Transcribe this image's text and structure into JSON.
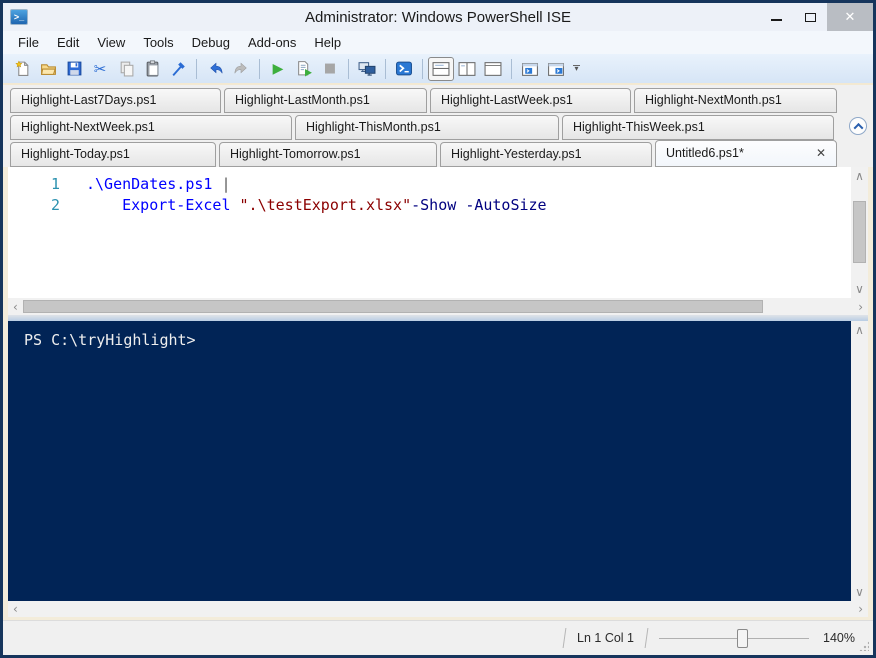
{
  "window": {
    "title": "Administrator: Windows PowerShell ISE",
    "minimize_glyph": "–",
    "close_glyph": "✕"
  },
  "menu": {
    "items": [
      "File",
      "Edit",
      "View",
      "Tools",
      "Debug",
      "Add-ons",
      "Help"
    ]
  },
  "toolbar": {
    "buttons": [
      "new-script",
      "open-script",
      "save-script",
      "cut",
      "copy",
      "paste",
      "clear-console-pane",
      "undo",
      "redo",
      "run-script",
      "run-selection",
      "stop-operation",
      "new-remote-powershell-tab",
      "start-powershell",
      "show-script-pane-top",
      "show-script-pane-right",
      "show-script-pane-maximized",
      "new-powershell-tab",
      "show-command-window",
      "toolbar-overflow"
    ]
  },
  "icons": {
    "cut": "✂",
    "run-script": "▶",
    "stop-operation": "■",
    "scroll-left": "‹",
    "scroll-right": "›",
    "scroll-up": "∧",
    "scroll-down": "∨",
    "overflow-arrow": "▾"
  },
  "tabs": {
    "rows": [
      [
        "Highlight-Last7Days.ps1",
        "Highlight-LastMonth.ps1",
        "Highlight-LastWeek.ps1",
        "Highlight-NextMonth.ps1"
      ],
      [
        "Highlight-NextWeek.ps1",
        "Highlight-ThisMonth.ps1",
        "Highlight-ThisWeek.ps1"
      ],
      [
        "Highlight-Today.ps1",
        "Highlight-Tomorrow.ps1",
        "Highlight-Yesterday.ps1"
      ]
    ],
    "active": "Untitled6.ps1*",
    "close_glyph": "✕"
  },
  "editor": {
    "line_numbers": [
      "1",
      "2"
    ],
    "line1": {
      "command": ".\\GenDates.ps1",
      "sep": " ",
      "pipe": "|"
    },
    "line2": {
      "indent": "    ",
      "command": "Export-Excel",
      "sep": " ",
      "string": "\".\\testExport.xlsx\"",
      "param1": "-Show",
      "sep2": " ",
      "param2": "-AutoSize"
    }
  },
  "console": {
    "prompt": "PS C:\\tryHighlight>"
  },
  "statusbar": {
    "line_col": "Ln 1 Col 1",
    "zoom_value": "140%"
  },
  "colors": {
    "console_background": "#012456",
    "command": "#0000FF",
    "string": "#8B0000",
    "parameter": "#000080",
    "operator": "#5A5A5A",
    "line_number": "#2B91AF",
    "window_border": "#16355C"
  }
}
